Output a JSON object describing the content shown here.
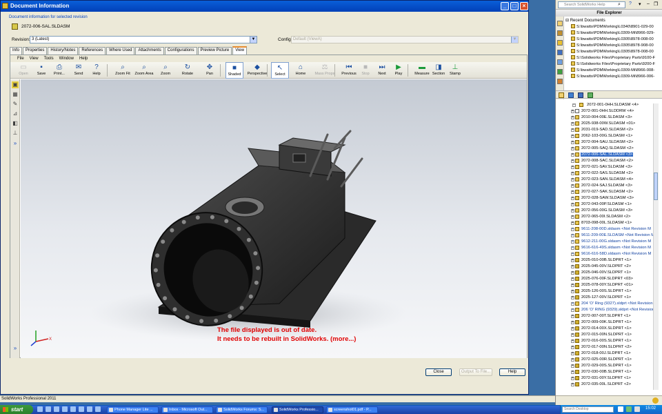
{
  "dialog": {
    "title": "Document Information",
    "subtitle": "Document information for selected revision",
    "file_name": "2072-006-SAL.SLDASM",
    "revision_label": "Revision:",
    "revision_value": "3 (Latest)",
    "config_label": "Config:",
    "config_value": "Default (ViewA)",
    "tabs": [
      "Info",
      "Properties",
      "History/Notes",
      "References",
      "Where Used",
      "Attachments",
      "Configurations",
      "Preview Picture",
      "View"
    ],
    "active_tab": "View",
    "buttons": {
      "close": "Close",
      "output": "Output To File...",
      "help": "Help"
    }
  },
  "viewer": {
    "menu": [
      "File",
      "View",
      "Tools",
      "Window",
      "Help"
    ],
    "toolbar": [
      {
        "label": "Open",
        "icon": "open-icon",
        "enabled": false
      },
      {
        "label": "Save",
        "icon": "save-icon",
        "enabled": true
      },
      {
        "label": "Print...",
        "icon": "print-icon",
        "enabled": true
      },
      {
        "label": "Send",
        "icon": "send-icon",
        "enabled": true
      },
      {
        "label": "Help",
        "icon": "help-icon",
        "enabled": true
      },
      {
        "label": "Zoom Fit",
        "icon": "zoom-fit-icon",
        "enabled": true
      },
      {
        "label": "Zoom Area",
        "icon": "zoom-area-icon",
        "enabled": true
      },
      {
        "label": "Zoom",
        "icon": "zoom-icon",
        "enabled": true
      },
      {
        "label": "Rotate",
        "icon": "rotate-icon",
        "enabled": true
      },
      {
        "label": "Pan",
        "icon": "pan-icon",
        "enabled": true
      },
      {
        "label": "Shaded",
        "icon": "shaded-icon",
        "enabled": true,
        "active": true
      },
      {
        "label": "Perspective",
        "icon": "perspective-icon",
        "enabled": true
      },
      {
        "label": "Select",
        "icon": "select-icon",
        "enabled": true,
        "active": true
      },
      {
        "label": "Home",
        "icon": "home-icon",
        "enabled": true
      },
      {
        "label": "Mass Props",
        "icon": "mass-props-icon",
        "enabled": false
      },
      {
        "label": "Previous",
        "icon": "previous-icon",
        "enabled": true
      },
      {
        "label": "Stop",
        "icon": "stop-icon",
        "enabled": false
      },
      {
        "label": "Next",
        "icon": "next-icon",
        "enabled": true
      },
      {
        "label": "Play",
        "icon": "play-icon",
        "enabled": true
      },
      {
        "label": "Measure",
        "icon": "measure-icon",
        "enabled": true
      },
      {
        "label": "Section",
        "icon": "section-icon",
        "enabled": true
      },
      {
        "label": "Stamp",
        "icon": "stamp-icon",
        "enabled": true
      }
    ],
    "out_of_date_line1": "The file displayed is out of date.",
    "out_of_date_line2": "It needs to be rebuilt in SolidWorks. (more...)"
  },
  "status_bar": "SolidWorks Professional 2011",
  "right_panel": {
    "search_placeholder": "Search SolidWorks Help",
    "header": "File Explorer",
    "recent_label": "Recent Documents",
    "recent": [
      "S:\\bwatts\\PDMWorking\\L0340\\8901-029-00",
      "S:\\bwatts\\PDMWorking\\L0309-Mi\\8966-029-",
      "S:\\bwatts\\PDMWorking\\L0305\\8978-008-00",
      "S:\\bwatts\\PDMWorking\\L0305\\8978-908-00",
      "S:\\bwatts\\PDMWorking\\L0305\\8978-008-00",
      "S:\\Solidworks Files\\Proprietary Parts\\9100-F",
      "S:\\Solidworks Files\\Proprietary Parts\\9200-F",
      "S:\\bwatts\\PDMWorking\\L0309-Mi\\8966-008-",
      "S:\\bwatts\\PDMWorking\\L0309-Mi\\8966-006-"
    ],
    "tree_root": "2072-001-0HH.SLDASM <4>",
    "tree": [
      {
        "label": "2072-001-0HH.SLDDRW <4>",
        "type": "drw"
      },
      {
        "label": "2010-004-00E.SLDASM <3>",
        "type": "asm"
      },
      {
        "label": "2025-938-00W.SLDASM <01>",
        "type": "asm"
      },
      {
        "label": "2031-019-SAD.SLDASM <2>",
        "type": "asm"
      },
      {
        "label": "2062-103-00G.SLDASM <1>",
        "type": "asm"
      },
      {
        "label": "2072-004-SAU.SLDASM <2>",
        "type": "asm"
      },
      {
        "label": "2072-005-SAQ.SLDASM <2>",
        "type": "asm"
      },
      {
        "label": "2072-006-SAL.SLDASM <3>",
        "type": "asm",
        "selected": true
      },
      {
        "label": "2072-008-SAC.SLDASM <2>",
        "type": "asm"
      },
      {
        "label": "2072-021-SAV.SLDASM <3>",
        "type": "asm"
      },
      {
        "label": "2072-022-SAS.SLDASM <2>",
        "type": "asm"
      },
      {
        "label": "2072-023-SAN.SLDASM <4>",
        "type": "asm"
      },
      {
        "label": "2072-024-SAJ.SLDASM <3>",
        "type": "asm"
      },
      {
        "label": "2072-027-SAK.SLDASM <2>",
        "type": "asm"
      },
      {
        "label": "2072-028-SAW.SLDASM <3>",
        "type": "asm"
      },
      {
        "label": "2072-043-00P.SLDASM <1>",
        "type": "asm"
      },
      {
        "label": "2072-056-00G.SLDASM <3>",
        "type": "asm"
      },
      {
        "label": "2072-065-00I.SLDASM <2>",
        "type": "asm"
      },
      {
        "label": "8703-098-00L.SLDASM <1>",
        "type": "asm"
      },
      {
        "label": "9611-208-00D.sldasm <Not Revision M",
        "type": "np"
      },
      {
        "label": "9611-209-00E.SLDASM <Not Revision M",
        "type": "np"
      },
      {
        "label": "9612-211-00G.sldasm <Not Revision M",
        "type": "np"
      },
      {
        "label": "9616-616-49S.sldasm <Not Revision M",
        "type": "np"
      },
      {
        "label": "9616-616-58D.sldasm <Not Revision M",
        "type": "np"
      },
      {
        "label": "2025-010-00B.SLDPRT <1>",
        "type": "prt"
      },
      {
        "label": "2025-045-00V.SLDPRT <2>",
        "type": "prt"
      },
      {
        "label": "2025-046-00V.SLDPRT <1>",
        "type": "prt"
      },
      {
        "label": "2025-076-00F.SLDPRT <03>",
        "type": "prt"
      },
      {
        "label": "2025-078-00Y.SLDPRT <01>",
        "type": "prt"
      },
      {
        "label": "2025-126-00S.SLDPRT <1>",
        "type": "prt"
      },
      {
        "label": "2025-127-00V.SLDPRT <1>",
        "type": "prt"
      },
      {
        "label": "204 'O' Ring (9327).sldprt <Not Revision",
        "type": "np"
      },
      {
        "label": "206 'O' RING (9329).sldprt <Not Revision",
        "type": "np"
      },
      {
        "label": "2072-007-00T.SLDPRT <1>",
        "type": "prt"
      },
      {
        "label": "2072-009-00K.SLDPRT <1>",
        "type": "prt"
      },
      {
        "label": "2072-014-00X.SLDPRT <1>",
        "type": "prt"
      },
      {
        "label": "2072-015-00N.SLDPRT <1>",
        "type": "prt"
      },
      {
        "label": "2072-016-00S.SLDPRT <1>",
        "type": "prt"
      },
      {
        "label": "2072-017-00N.SLDPRT <2>",
        "type": "prt"
      },
      {
        "label": "2072-018-00J.SLDPRT <1>",
        "type": "prt"
      },
      {
        "label": "2072-025-00R.SLDPRT <1>",
        "type": "prt"
      },
      {
        "label": "2072-029-00S.SLDPRT <1>",
        "type": "prt"
      },
      {
        "label": "2072-030-00B.SLDPRT <1>",
        "type": "prt"
      },
      {
        "label": "2072-031-00Y.SLDPRT <1>",
        "type": "prt"
      },
      {
        "label": "2072-035-00L.SLDPRT <2>",
        "type": "prt"
      }
    ]
  },
  "taskbar": {
    "start": "start",
    "tasks": [
      {
        "label": "Phone Manager Lite ...",
        "active": false
      },
      {
        "label": "Inbox - Microsoft Out...",
        "active": false
      },
      {
        "label": "SolidWorks Forums: S...",
        "active": false
      },
      {
        "label": "SolidWorks Professio...",
        "active": true
      },
      {
        "label": "screenshot01.pdf - P...",
        "active": false
      }
    ],
    "search_placeholder": "Search Desktop",
    "clock": "15:02"
  }
}
